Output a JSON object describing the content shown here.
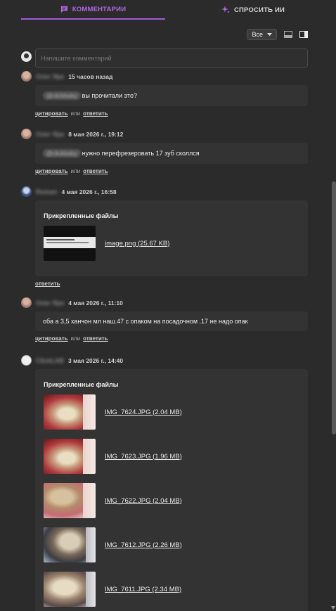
{
  "tabs": {
    "comments": "КОММЕНТАРИИ",
    "ask_ai": "СПРОСИТЬ ИИ"
  },
  "toolbar": {
    "filter_value": "Все"
  },
  "composer": {
    "placeholder": "Напишите комментарий"
  },
  "actions": {
    "quote": "цитировать",
    "or": "или",
    "reply": "ответить"
  },
  "attachments_title": "Прикрепленные файлы",
  "comments": [
    {
      "author": "Олег Ярк",
      "time": "15 часов назад",
      "mention": "@clickbaby",
      "text": "вы прочитали это?"
    },
    {
      "author": "Олег Ярк",
      "time": "8 мая 2026 г., 19:12",
      "mention": "@clickbaby",
      "text": "нужно перефрезеровать 17 зуб сколлся"
    },
    {
      "author": "Roman",
      "time": "4 мая 2026 г., 16:58",
      "files": [
        {
          "name": "image.png (25.67 KB)"
        }
      ]
    },
    {
      "author": "Олег Ярк",
      "time": "4 мая 2026 г., 11:10",
      "text": "оба а 3,5 ханчон мл наш.47 с опаком на посадочном .17 не надо опак"
    },
    {
      "author": "ClickLAB",
      "time": "3 мая 2026 г., 14:40",
      "files": [
        {
          "name": "IMG_7624.JPG (2.04 MB)"
        },
        {
          "name": "IMG_7623.JPG (1.96 MB)"
        },
        {
          "name": "IMG_7622.JPG (2.04 MB)"
        },
        {
          "name": "IMG_7612.JPG (2.26 MB)"
        },
        {
          "name": "IMG_7611.JPG (2.34 MB)"
        }
      ]
    }
  ],
  "colors": {
    "accent": "#a05bd8",
    "background": "#2b2b2b",
    "card": "#333333"
  }
}
